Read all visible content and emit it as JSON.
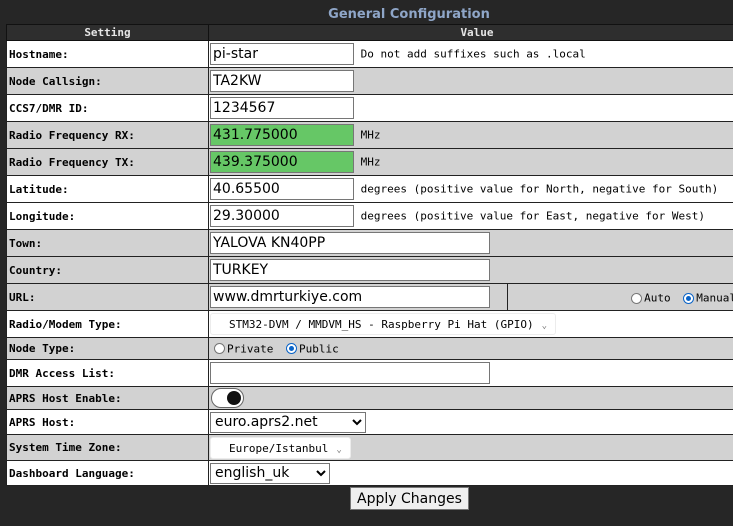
{
  "section_title": "General Configuration",
  "table": {
    "col_setting": "Setting",
    "col_value": "Value"
  },
  "rows": {
    "hostname": {
      "label": "Hostname:",
      "value": "pi-star",
      "note": "Do not add suffixes such as .local"
    },
    "callsign": {
      "label": "Node Callsign:",
      "value": "TA2KW"
    },
    "dmr_id": {
      "label": "CCS7/DMR ID:",
      "value": "1234567"
    },
    "freq_rx": {
      "label": "Radio Frequency RX:",
      "value": "431.775000",
      "unit": "MHz",
      "highlight_color": "#66c766"
    },
    "freq_tx": {
      "label": "Radio Frequency TX:",
      "value": "439.375000",
      "unit": "MHz",
      "highlight_color": "#66c766"
    },
    "latitude": {
      "label": "Latitude:",
      "value": "40.65500",
      "note": "degrees (positive value for North, negative for South)"
    },
    "longitude": {
      "label": "Longitude:",
      "value": "29.30000",
      "note": "degrees (positive value for East, negative for West)"
    },
    "town": {
      "label": "Town:",
      "value": "YALOVA KN40PP"
    },
    "country": {
      "label": "Country:",
      "value": "TURKEY"
    },
    "url": {
      "label": "URL:",
      "value": "www.dmrturkiye.com",
      "auto_label": "Auto",
      "manual_label": "Manual",
      "selected": "Manual"
    },
    "modem": {
      "label": "Radio/Modem Type:",
      "value": "STM32-DVM / MMDVM_HS - Raspberry Pi Hat (GPIO)"
    },
    "node_type": {
      "label": "Node Type:",
      "private_label": "Private",
      "public_label": "Public",
      "selected": "Public"
    },
    "dmr_access": {
      "label": "DMR Access List:",
      "value": ""
    },
    "aprs_enable": {
      "label": "APRS Host Enable:",
      "state": "on"
    },
    "aprs_host": {
      "label": "APRS Host:",
      "value": "euro.aprs2.net"
    },
    "timezone": {
      "label": "System Time Zone:",
      "value": "Europe/Istanbul"
    },
    "language": {
      "label": "Dashboard Language:",
      "value": "english_uk"
    }
  },
  "apply_label": "Apply Changes",
  "icons": {
    "dropdown": "chevron-down-icon",
    "radio": "radio-icon",
    "toggle": "toggle-switch"
  }
}
